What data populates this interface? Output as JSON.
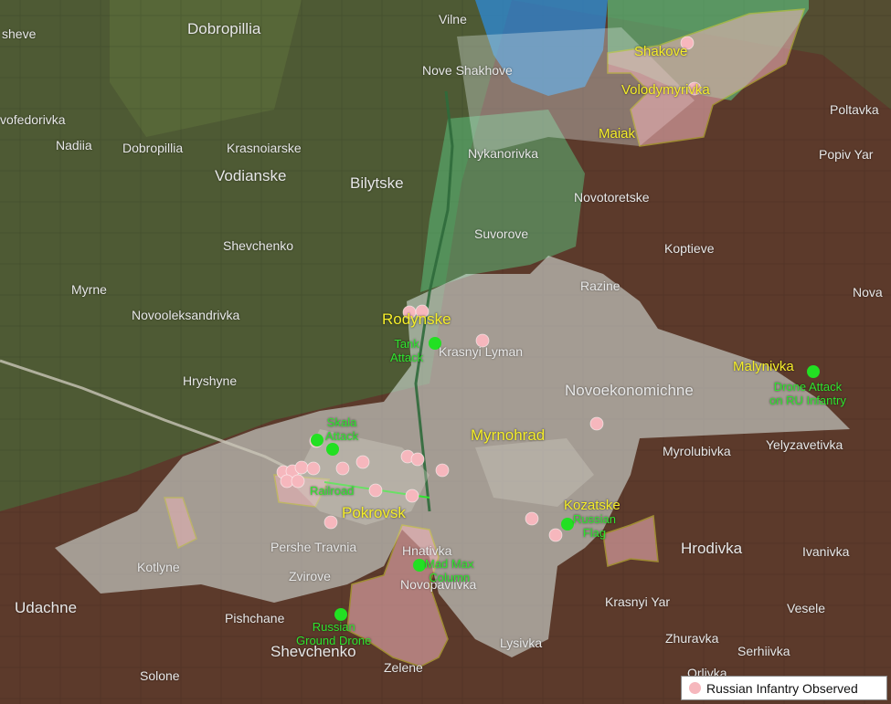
{
  "colors": {
    "russian_controlled": "#f6b7bd",
    "contested": "#e0ece9",
    "ukrainian_advance": "#5ed38a",
    "flood_area": "#2d8bd8",
    "highlight_label": "#f5ee2a",
    "event_marker": "#22e022",
    "infantry_marker": "#f6b7bd",
    "place_label": "#e8e8e8"
  },
  "places": [
    {
      "id": "sheve",
      "text": "sheve"
    },
    {
      "id": "dobropillia-top",
      "text": "Dobropillia"
    },
    {
      "id": "vilne",
      "text": "Vilne"
    },
    {
      "id": "nove-shakhove",
      "text": "Nove Shakhove"
    },
    {
      "id": "vofedorivka",
      "text": "vofedorivka"
    },
    {
      "id": "nadiia",
      "text": "Nadiia"
    },
    {
      "id": "dobropillia",
      "text": "Dobropillia"
    },
    {
      "id": "krasnoiarske",
      "text": "Krasnoiarske"
    },
    {
      "id": "vodianske",
      "text": "Vodianske"
    },
    {
      "id": "bilytske",
      "text": "Bilytske"
    },
    {
      "id": "nykanorivka",
      "text": "Nykanorivka"
    },
    {
      "id": "poltavka",
      "text": "Poltavka"
    },
    {
      "id": "popiv-yar",
      "text": "Popiv Yar"
    },
    {
      "id": "novotoretske",
      "text": "Novotoretske"
    },
    {
      "id": "suvorove",
      "text": "Suvorove"
    },
    {
      "id": "shevchenko-n",
      "text": "Shevchenko"
    },
    {
      "id": "koptieve",
      "text": "Koptieve"
    },
    {
      "id": "myrne",
      "text": "Myrne"
    },
    {
      "id": "razine",
      "text": "Razine"
    },
    {
      "id": "nova",
      "text": "Nova"
    },
    {
      "id": "novooleksandrivka",
      "text": "Novooleksandrivka"
    },
    {
      "id": "krasnyi-lyman",
      "text": "Krasnyi Lyman"
    },
    {
      "id": "hryshyne",
      "text": "Hryshyne"
    },
    {
      "id": "novoekonomichne",
      "text": "Novoekonomichne"
    },
    {
      "id": "myrolubivka",
      "text": "Myrolubivka"
    },
    {
      "id": "yelyzavetivka",
      "text": "Yelyzavetivka"
    },
    {
      "id": "pershe-travnia",
      "text": "Pershe Travnia"
    },
    {
      "id": "hnativka",
      "text": "Hnativka"
    },
    {
      "id": "hrodivka",
      "text": "Hrodivka"
    },
    {
      "id": "ivanivka",
      "text": "Ivanivka"
    },
    {
      "id": "kotlyne",
      "text": "Kotlyne"
    },
    {
      "id": "zvirove",
      "text": "Zvirove"
    },
    {
      "id": "novopavlivka",
      "text": "Novopavlivka"
    },
    {
      "id": "udachne",
      "text": "Udachne"
    },
    {
      "id": "krasnyi-yar",
      "text": "Krasnyi Yar"
    },
    {
      "id": "vesele",
      "text": "Vesele"
    },
    {
      "id": "pishchane",
      "text": "Pishchane"
    },
    {
      "id": "zhuravka",
      "text": "Zhuravka"
    },
    {
      "id": "shevchenko-s",
      "text": "Shevchenko"
    },
    {
      "id": "lysivka",
      "text": "Lysivka"
    },
    {
      "id": "serhiivka",
      "text": "Serhiivka"
    },
    {
      "id": "solone",
      "text": "Solone"
    },
    {
      "id": "zelene",
      "text": "Zelene"
    },
    {
      "id": "orlivka",
      "text": "Orlivka"
    }
  ],
  "highlighted_places": [
    {
      "id": "shakove",
      "text": "Shakove"
    },
    {
      "id": "volodymyrivka",
      "text": "Volodymyrivka"
    },
    {
      "id": "maiak",
      "text": "Maiak"
    },
    {
      "id": "rodynske",
      "text": "Rodynske"
    },
    {
      "id": "malynivka",
      "text": "Malynivka"
    },
    {
      "id": "myrnohrad",
      "text": "Myrnohrad"
    },
    {
      "id": "kozatske",
      "text": "Kozatske"
    },
    {
      "id": "pokrovsk",
      "text": "Pokrovsk"
    }
  ],
  "events": [
    {
      "id": "tank-attack",
      "lines": [
        "Tank",
        "Attack"
      ]
    },
    {
      "id": "drone-attack",
      "lines": [
        "Drone Attack",
        "on RU Infantry"
      ]
    },
    {
      "id": "skala-attack",
      "lines": [
        "Skala",
        "Attack"
      ]
    },
    {
      "id": "railroad",
      "lines": [
        "Railroad"
      ]
    },
    {
      "id": "russian-flag",
      "lines": [
        "Russian",
        "Flag"
      ]
    },
    {
      "id": "mad-max-column",
      "lines": [
        "Mad Max",
        "Column"
      ]
    },
    {
      "id": "russian-ground-drone",
      "lines": [
        "Russian",
        "Ground Drone"
      ]
    }
  ],
  "legend": {
    "label": "Russian Infantry Observed"
  }
}
